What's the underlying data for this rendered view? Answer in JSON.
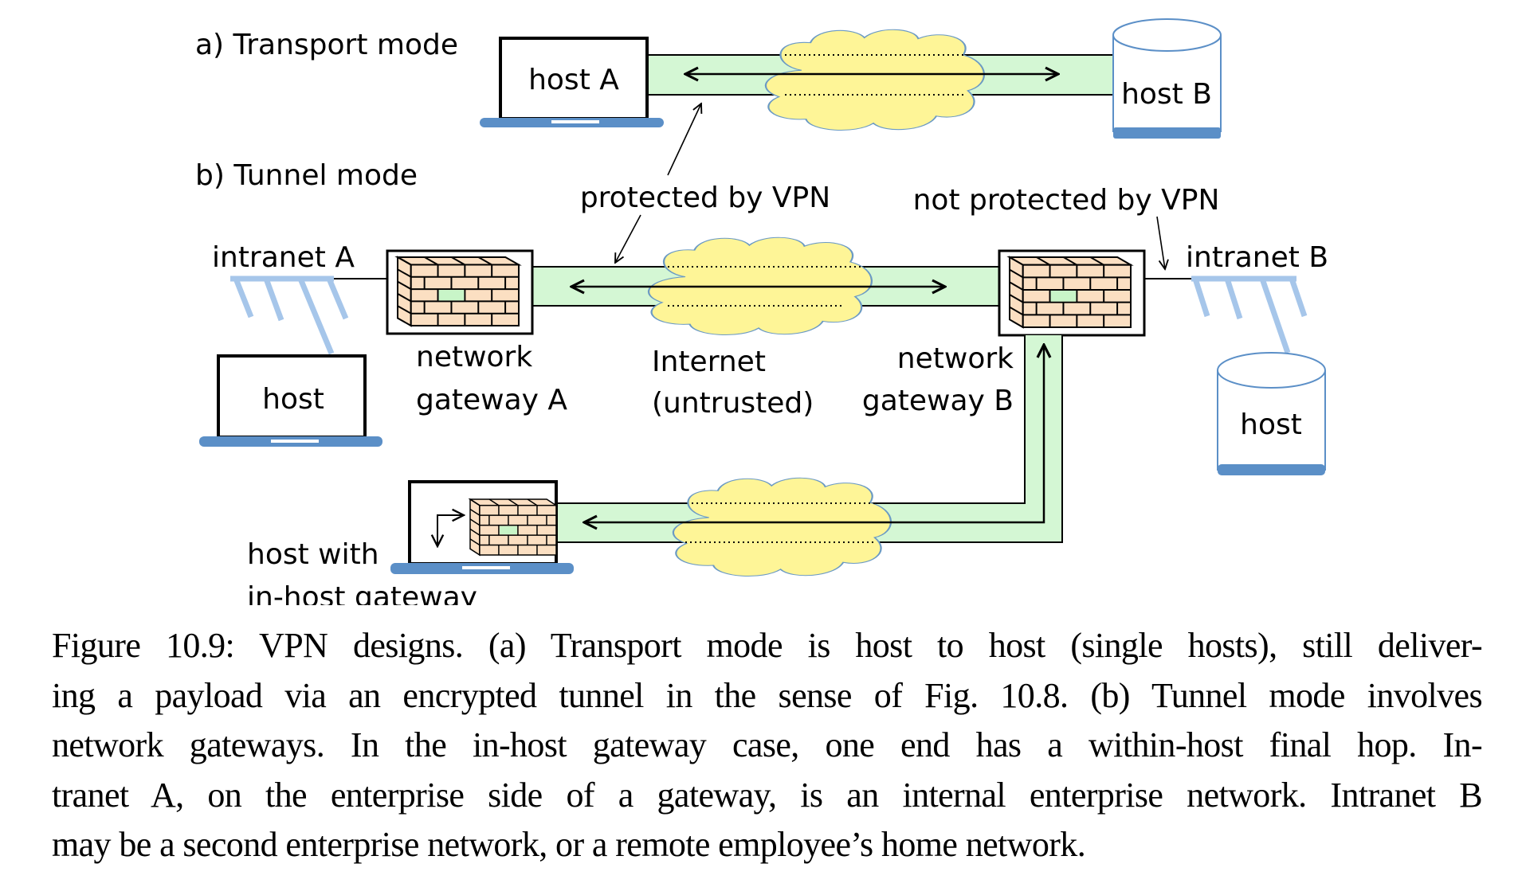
{
  "figure": {
    "section_a_title": "a) Transport mode",
    "section_b_title": "b) Tunnel mode",
    "host_a": "host A",
    "host_b": "host B",
    "protected_label": "protected by VPN",
    "not_protected_label": "not protected by VPN",
    "intranet_a": "intranet A",
    "intranet_b": "intranet B",
    "host_left": "host",
    "host_right": "host",
    "gateway_a_line1": "network",
    "gateway_a_line2": "gateway A",
    "internet_line1": "Internet",
    "internet_line2": "(untrusted)",
    "gateway_b_line1": "network",
    "gateway_b_line2": "gateway B",
    "inhost_line1": "host with",
    "inhost_line2": "in-host gateway",
    "colors": {
      "tunnel_fill": "#d4f7d4",
      "cloud_fill": "#fef597",
      "cloud_stroke": "#6b9ac4",
      "device_blue": "#5b8fc7",
      "bus_blue": "#a6c6ea",
      "brick_fill": "#fbdfc2",
      "brick_green": "#c8f5c8"
    }
  },
  "caption": {
    "lines": [
      "Figure 10.9:  VPN designs. (a) Transport mode is host to host (single hosts), still deliver-",
      "ing a payload via an encrypted tunnel in the sense of Fig. 10.8. (b) Tunnel mode involves",
      "network gateways.  In the in-host gateway case, one end has a within-host final hop.  In-",
      "tranet A, on the enterprise side of a gateway, is an internal enterprise network. Intranet B",
      "may be a second enterprise network, or a remote employee’s home network."
    ]
  }
}
